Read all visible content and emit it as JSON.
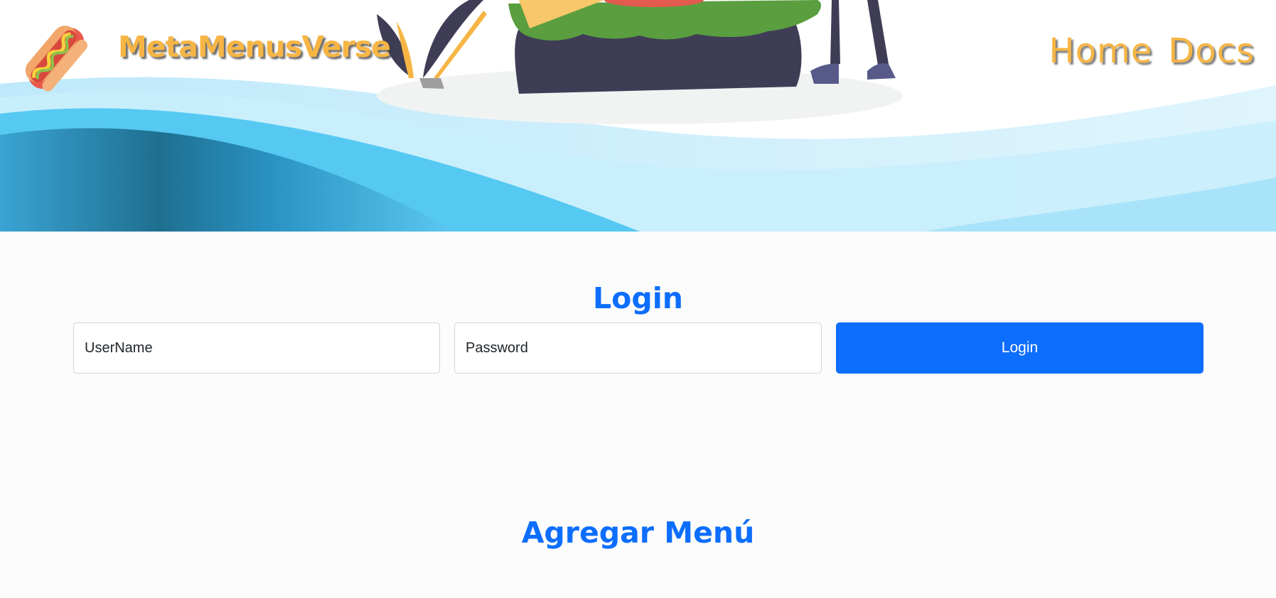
{
  "brand": {
    "name": "MetaMenusVerse",
    "logo_icon": "hotdog-icon",
    "accent_color": "#f6b544"
  },
  "nav": {
    "items": [
      "Home",
      "Docs"
    ]
  },
  "login": {
    "title": "Login",
    "username_placeholder": "UserName",
    "password_placeholder": "Password",
    "button_label": "Login",
    "button_color": "#0d6efd"
  },
  "menu_section": {
    "title": "Agregar Menú"
  }
}
